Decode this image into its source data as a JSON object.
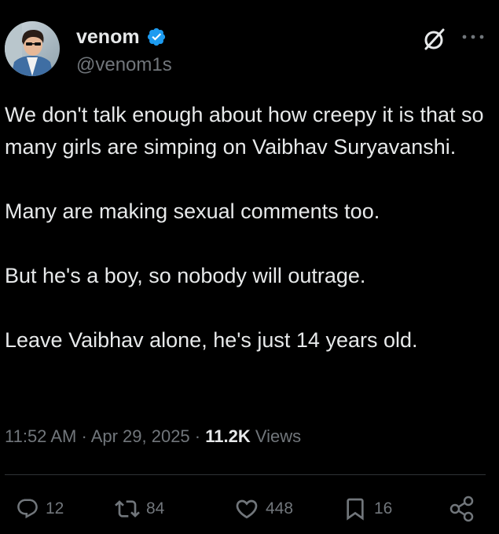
{
  "author": {
    "display_name": "venom",
    "handle": "@venom1s",
    "verified": true,
    "verified_color": "#1d9bf0"
  },
  "tweet": {
    "paragraphs": [
      "We don't talk enough about how creepy it is that so many girls are simping on Vaibhav Suryavanshi.",
      "Many are making sexual comments too.",
      "But he's a boy, so nobody will outrage.",
      "Leave Vaibhav alone, he's just 14 years old."
    ]
  },
  "meta": {
    "time": "11:52 AM",
    "separator": "·",
    "date": "Apr 29, 2025",
    "views_count": "11.2K",
    "views_label": "Views"
  },
  "actions": {
    "reply_count": "12",
    "retweet_count": "84",
    "like_count": "448",
    "bookmark_count": "16"
  },
  "icons": {
    "verified": "verified-badge-icon",
    "grok": "grok-icon",
    "more": "more-dots-icon",
    "reply": "reply-icon",
    "retweet": "retweet-icon",
    "like": "heart-icon",
    "bookmark": "bookmark-icon",
    "share": "share-icon"
  },
  "colors": {
    "background": "#000000",
    "text_primary": "#e7e9ea",
    "text_secondary": "#71767b",
    "divider": "#2f3336"
  }
}
